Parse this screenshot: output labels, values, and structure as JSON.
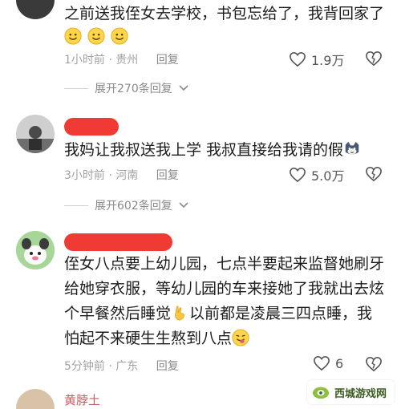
{
  "comments": [
    {
      "line1": "之前送我侄女去学校，书包忘给了，我背回家了",
      "meta_time": "1小时前",
      "meta_location": "贵州",
      "reply": "回复",
      "likes": "1.9万",
      "expand": "展开270条回复"
    },
    {
      "line1": "我妈让我叔送我上学 我叔直接给我请的假",
      "meta_time": "3小时前",
      "meta_location": "河南",
      "reply": "回复",
      "likes": "5.0万",
      "expand": "展开602条回复"
    },
    {
      "line1": "侄女八点要上幼儿园，七点半要起来监督她刷牙",
      "line2": "给她穿衣服，等幼儿园的车来接她了我就出去炫",
      "line3a": "个早餐然后睡觉",
      "line3b": "以前都是凌晨三四点睡，我",
      "line4": "怕起不来硬生生熬到八点",
      "meta_time": "5分钟前",
      "meta_location": "广东",
      "reply": "回复",
      "likes": "6"
    }
  ],
  "next_comment_partial": "黄脖土",
  "meta_separator": " · ",
  "watermark": "西城游戏网",
  "colors": {
    "redaction": "#ef3b34",
    "meta": "#a2a2a2",
    "text": "#1c1c1c"
  },
  "icons": [
    "heart-outline-icon",
    "broken-heart-icon",
    "smile-emoji-icon",
    "cat-emoji-icon",
    "ok-hand-emoji-icon",
    "tongue-emoji-icon",
    "chevron-down-icon"
  ]
}
